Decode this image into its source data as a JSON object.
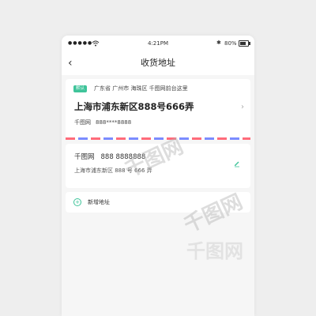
{
  "statusbar": {
    "signal": "●●●●●",
    "time": "4:21PM",
    "bluetooth": "✱",
    "battery_pct": "80%",
    "battery_level": 0.8
  },
  "navbar": {
    "back": "‹",
    "title": "收货地址"
  },
  "default_address": {
    "badge": "默认",
    "region": "广东省  广州市  海珠区  千图网前台这里",
    "address": "上海市浦东新区888号666弄",
    "name": "千图网",
    "phone": "888****8888"
  },
  "address_item": {
    "name": "千图网",
    "phone": "888 8888888",
    "address": "上海市浦东新区 888 号 666 弄"
  },
  "add_address": {
    "label": "新增地址"
  },
  "watermark": {
    "text1": "千图网",
    "text2": "千图网",
    "text3": "千图网"
  },
  "colors": {
    "accent": "#3fc49a",
    "stripe_red": "#ff6b7a",
    "stripe_blue": "#7b8cff"
  }
}
